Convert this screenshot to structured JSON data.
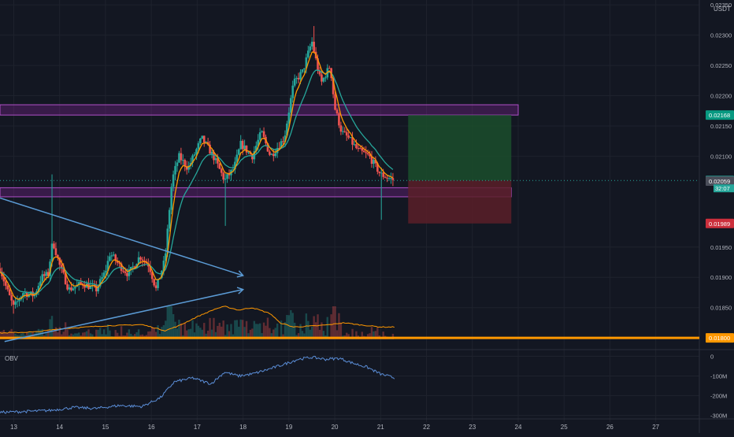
{
  "currency_label": "USDT",
  "obv_label": "OBV",
  "chart_data": {
    "type": "line",
    "title": "",
    "xlabel": "",
    "ylabel": "",
    "date_ticks": [
      "13",
      "14",
      "15",
      "16",
      "17",
      "18",
      "19",
      "20",
      "21",
      "22",
      "23",
      "24",
      "25",
      "26",
      "27"
    ],
    "price_ticks": [
      {
        "value": 0.0235,
        "label": "0.02350"
      },
      {
        "value": 0.023,
        "label": "0.02300"
      },
      {
        "value": 0.0225,
        "label": "0.02250"
      },
      {
        "value": 0.022,
        "label": "0.02200"
      },
      {
        "value": 0.0215,
        "label": "0.02150"
      },
      {
        "value": 0.021,
        "label": "0.02100"
      },
      {
        "value": 0.0195,
        "label": "0.01950"
      },
      {
        "value": 0.019,
        "label": "0.01900"
      },
      {
        "value": 0.0185,
        "label": "0.01850"
      }
    ],
    "obv_ticks": [
      {
        "value": 0,
        "label": "0"
      },
      {
        "value": -100,
        "label": "-100M"
      },
      {
        "value": -200,
        "label": "-200M"
      },
      {
        "value": -300,
        "label": "-300M"
      }
    ],
    "ylim": [
      0.01782,
      0.02358
    ],
    "obv_ylim": [
      -310,
      30
    ],
    "xlim": [
      12.7,
      27.95
    ],
    "price_badges": [
      {
        "value": 0.02168,
        "label": "0.02168",
        "color": "#089981"
      },
      {
        "value": 0.0206,
        "label": "0.02060",
        "color": "#26a69a"
      },
      {
        "value": 0.02059,
        "label": "0.02059",
        "color": "#4a4e5a"
      },
      {
        "value": 0.01989,
        "label": "0.01989",
        "color": "#cc2f3c"
      },
      {
        "value": 0.018,
        "label": "0.01800",
        "color": "#ff9800"
      }
    ],
    "countdown": "32:07",
    "support_level": 0.018,
    "zones": [
      {
        "from": 0.02168,
        "to": 0.02185,
        "x_start": 12.7,
        "x_end": 24.0,
        "color": "#9c27b0"
      },
      {
        "from": 0.02033,
        "to": 0.02048,
        "x_start": 12.7,
        "x_end": 23.85,
        "color": "#9c27b0"
      }
    ],
    "position": {
      "entry": 0.0206,
      "target": 0.02168,
      "stop": 0.01989,
      "x_start": 21.6,
      "x_end": 23.85
    },
    "trendlines": [
      {
        "x1": 12.7,
        "y1": 0.02031,
        "x2": 18.0,
        "y2": 0.01903,
        "arrow": true
      },
      {
        "x1": 12.8,
        "y1": 0.01794,
        "x2": 18.0,
        "y2": 0.0188,
        "arrow": true
      }
    ],
    "series": [
      {
        "kind": "candles",
        "color_up": "#26a69a",
        "color_down": "#ef5350",
        "candles": []
      },
      {
        "kind": "ma",
        "color": "#ff9800",
        "values": []
      },
      {
        "kind": "ma",
        "color": "#26a69a",
        "values": []
      },
      {
        "kind": "volume_ma",
        "color": "#ff9800",
        "values": []
      },
      {
        "kind": "obv",
        "color": "#5b8ed8",
        "values": []
      }
    ],
    "anchors": [
      [
        12.7,
        0.01915
      ],
      [
        12.85,
        0.0188
      ],
      [
        13.0,
        0.0185
      ],
      [
        13.2,
        0.01875
      ],
      [
        13.45,
        0.0187
      ],
      [
        13.6,
        0.019
      ],
      [
        13.75,
        0.01905
      ],
      [
        13.85,
        0.0196
      ],
      [
        14.0,
        0.0192
      ],
      [
        14.2,
        0.0188
      ],
      [
        14.5,
        0.0189
      ],
      [
        14.8,
        0.0188
      ],
      [
        15.0,
        0.0191
      ],
      [
        15.1,
        0.0194
      ],
      [
        15.3,
        0.0192
      ],
      [
        15.5,
        0.01905
      ],
      [
        15.75,
        0.01935
      ],
      [
        15.95,
        0.0192
      ],
      [
        16.1,
        0.0188
      ],
      [
        16.3,
        0.0193
      ],
      [
        16.45,
        0.0206
      ],
      [
        16.6,
        0.021
      ],
      [
        16.8,
        0.0208
      ],
      [
        17.1,
        0.0213
      ],
      [
        17.35,
        0.021
      ],
      [
        17.6,
        0.0206
      ],
      [
        17.8,
        0.0208
      ],
      [
        17.95,
        0.0212
      ],
      [
        18.2,
        0.021
      ],
      [
        18.4,
        0.0214
      ],
      [
        18.6,
        0.021
      ],
      [
        18.9,
        0.0213
      ],
      [
        19.1,
        0.0222
      ],
      [
        19.3,
        0.0224
      ],
      [
        19.5,
        0.0229
      ],
      [
        19.7,
        0.0222
      ],
      [
        19.9,
        0.0225
      ],
      [
        20.0,
        0.0218
      ],
      [
        20.15,
        0.0214
      ],
      [
        20.3,
        0.0213
      ],
      [
        20.5,
        0.0211
      ],
      [
        20.75,
        0.021
      ],
      [
        21.0,
        0.0207
      ],
      [
        21.3,
        0.0206
      ]
    ],
    "obv_anchors": [
      [
        12.7,
        -285
      ],
      [
        13.3,
        -280
      ],
      [
        13.8,
        -275
      ],
      [
        14.3,
        -260
      ],
      [
        14.8,
        -265
      ],
      [
        15.3,
        -250
      ],
      [
        15.8,
        -255
      ],
      [
        16.2,
        -210
      ],
      [
        16.5,
        -130
      ],
      [
        16.9,
        -110
      ],
      [
        17.3,
        -140
      ],
      [
        17.6,
        -80
      ],
      [
        17.9,
        -100
      ],
      [
        18.2,
        -90
      ],
      [
        18.5,
        -70
      ],
      [
        18.9,
        -40
      ],
      [
        19.2,
        -15
      ],
      [
        19.5,
        -5
      ],
      [
        19.8,
        -15
      ],
      [
        20.1,
        -10
      ],
      [
        20.4,
        -35
      ],
      [
        20.7,
        -55
      ],
      [
        21.0,
        -90
      ],
      [
        21.3,
        -110
      ]
    ],
    "vol_ma_anchors": [
      [
        12.7,
        0.01808
      ],
      [
        13.5,
        0.0181
      ],
      [
        14.0,
        0.01815
      ],
      [
        15.0,
        0.0182
      ],
      [
        15.8,
        0.01822
      ],
      [
        16.3,
        0.01812
      ],
      [
        16.6,
        0.0182
      ],
      [
        17.0,
        0.01835
      ],
      [
        17.4,
        0.01848
      ],
      [
        17.6,
        0.01852
      ],
      [
        17.9,
        0.01846
      ],
      [
        18.2,
        0.0185
      ],
      [
        18.6,
        0.0184
      ],
      [
        18.8,
        0.01825
      ],
      [
        19.1,
        0.01818
      ],
      [
        19.6,
        0.0182
      ],
      [
        19.9,
        0.01822
      ],
      [
        20.2,
        0.01825
      ],
      [
        20.5,
        0.01822
      ],
      [
        21.0,
        0.01818
      ],
      [
        21.3,
        0.01818
      ]
    ]
  }
}
